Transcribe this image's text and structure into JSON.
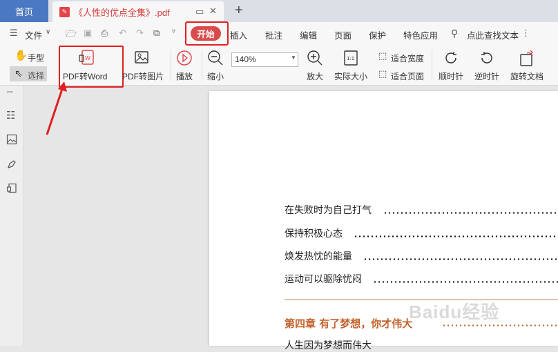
{
  "tabs": {
    "home": "首页",
    "doc_title": "《人性的优点全集》.pdf",
    "new_tab": "+"
  },
  "menu": {
    "file": "文件",
    "start": "开始",
    "insert": "插入",
    "annotate": "批注",
    "edit": "编辑",
    "page": "页面",
    "protect": "保护",
    "features": "特色应用",
    "search": "点此查找文本"
  },
  "ribbon": {
    "hand": "手型",
    "select": "选择",
    "pdf_to_word": "PDF转Word",
    "pdf_to_image": "PDF转图片",
    "play": "播放",
    "zoom_out": "缩小",
    "zoom_value": "140%",
    "zoom_in": "放大",
    "actual_size": "实际大小",
    "fit_width": "适合宽度",
    "fit_page": "适合页面",
    "rotate_cw": "顺时针",
    "rotate_ccw": "逆时针",
    "rotate_doc": "旋转文档"
  },
  "document": {
    "toc": [
      "在失败时为自己打气",
      "保持积极心态",
      "焕发热忱的能量",
      "运动可以驱除忧闷"
    ],
    "chapter": "第四章  有了梦想，你才伟大",
    "next_line": "人生因为梦想而伟大"
  },
  "watermark": "Baidu经验",
  "colors": {
    "accent_red": "#d84c4c",
    "home_tab_blue": "#4a78c2",
    "chapter_orange": "#c4602a",
    "highlight_red": "#e02020"
  }
}
